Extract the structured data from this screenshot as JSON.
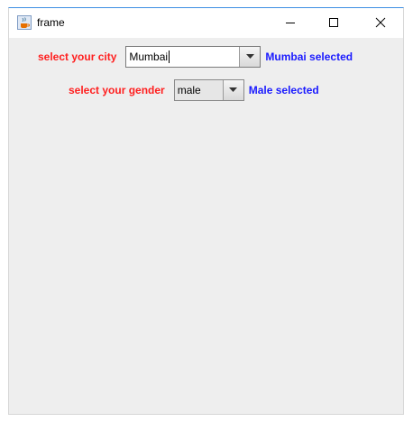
{
  "window": {
    "title": "frame"
  },
  "city": {
    "label": "select your city",
    "value": "Mumbai",
    "status": "Mumbai selected"
  },
  "gender": {
    "label": "select your gender",
    "value": "male",
    "status": "Male selected"
  },
  "colors": {
    "label_red": "#ff1f1f",
    "status_blue": "#1a1aff",
    "window_bg": "#eeeeee",
    "title_border": "#3c8fe3"
  },
  "icons": {
    "app": "java-coffee-cup-icon",
    "minimize": "minimize-icon",
    "maximize": "maximize-icon",
    "close": "close-icon",
    "dropdown": "chevron-down-icon"
  }
}
